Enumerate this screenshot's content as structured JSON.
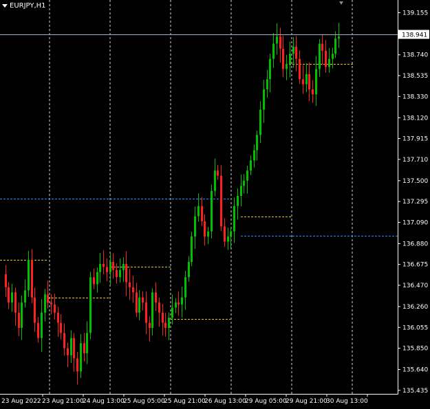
{
  "header": {
    "symbol_label": "EURJPY,H1"
  },
  "chart_data": {
    "type": "candlestick",
    "symbol": "EURJPY",
    "timeframe": "H1",
    "ylim": [
      135.4,
      139.28
    ],
    "y_ticks": [
      "139.155",
      "138.945",
      "138.740",
      "138.535",
      "138.330",
      "138.120",
      "137.915",
      "137.710",
      "137.500",
      "137.295",
      "137.090",
      "136.880",
      "136.675",
      "136.470",
      "136.260",
      "136.055",
      "135.850",
      "135.640",
      "135.435"
    ],
    "x_ticks": [
      "23 Aug 2022",
      "23 Aug 21:00",
      "24 Aug 13:00",
      "25 Aug 05:00",
      "25 Aug 21:00",
      "26 Aug 13:00",
      "29 Aug 05:00",
      "29 Aug 21:00",
      "30 Aug 13:00"
    ],
    "current_price": "138.941",
    "levels": [
      {
        "price": 137.32,
        "color": "#1e90ff",
        "style": "dashed",
        "span": "left"
      },
      {
        "price": 136.96,
        "color": "#1e90ff",
        "style": "dashed",
        "span": "right"
      },
      {
        "price": 136.72,
        "color": "#e6c619",
        "style": "dashed",
        "span": "segment"
      },
      {
        "price": 136.35,
        "color": "#e6c619",
        "style": "dashed",
        "span": "segment"
      },
      {
        "price": 136.65,
        "color": "#e6c619",
        "style": "dashed",
        "span": "segment"
      },
      {
        "price": 136.14,
        "color": "#e6c619",
        "style": "dashed",
        "span": "segment"
      },
      {
        "price": 137.15,
        "color": "#e6c619",
        "style": "dashed",
        "span": "segment"
      },
      {
        "price": 138.65,
        "color": "#e6c619",
        "style": "dashed",
        "span": "segment"
      }
    ],
    "ohlc_path": [
      136.58,
      136.45,
      136.3,
      136.4,
      136.2,
      136.05,
      136.3,
      136.42,
      136.72,
      136.35,
      136.1,
      135.95,
      136.2,
      136.38,
      136.3,
      136.28,
      136.2,
      136.1,
      136.0,
      135.85,
      135.78,
      135.95,
      135.75,
      135.62,
      135.9,
      135.8,
      136.0,
      136.55,
      136.48,
      136.6,
      136.68,
      136.65,
      136.6,
      136.7,
      136.62,
      136.55,
      136.62,
      136.68,
      136.5,
      136.45,
      136.4,
      136.2,
      136.35,
      136.3,
      136.1,
      136.05,
      136.4,
      136.3,
      136.2,
      136.1,
      136.05,
      136.15,
      136.25,
      136.3,
      136.28,
      136.35,
      136.55,
      136.7,
      136.95,
      137.15,
      137.25,
      137.1,
      136.95,
      137.0,
      137.4,
      137.6,
      137.55,
      137.05,
      136.9,
      136.95,
      137.0,
      137.25,
      137.35,
      137.45,
      137.5,
      137.6,
      137.7,
      137.8,
      137.95,
      138.2,
      138.4,
      138.5,
      138.7,
      138.85,
      138.92,
      138.8,
      138.6,
      138.65,
      138.75,
      138.82,
      138.7,
      138.5,
      138.45,
      138.55,
      138.4,
      138.35,
      138.6,
      138.85,
      138.78,
      138.62,
      138.7,
      138.75,
      138.9,
      138.92
    ]
  },
  "colors": {
    "background": "#000000",
    "bull": "#00c000",
    "bear": "#ff2020",
    "grid": "#ffffff",
    "axis": "#ffffff",
    "price_line": "#a0b4d0"
  }
}
